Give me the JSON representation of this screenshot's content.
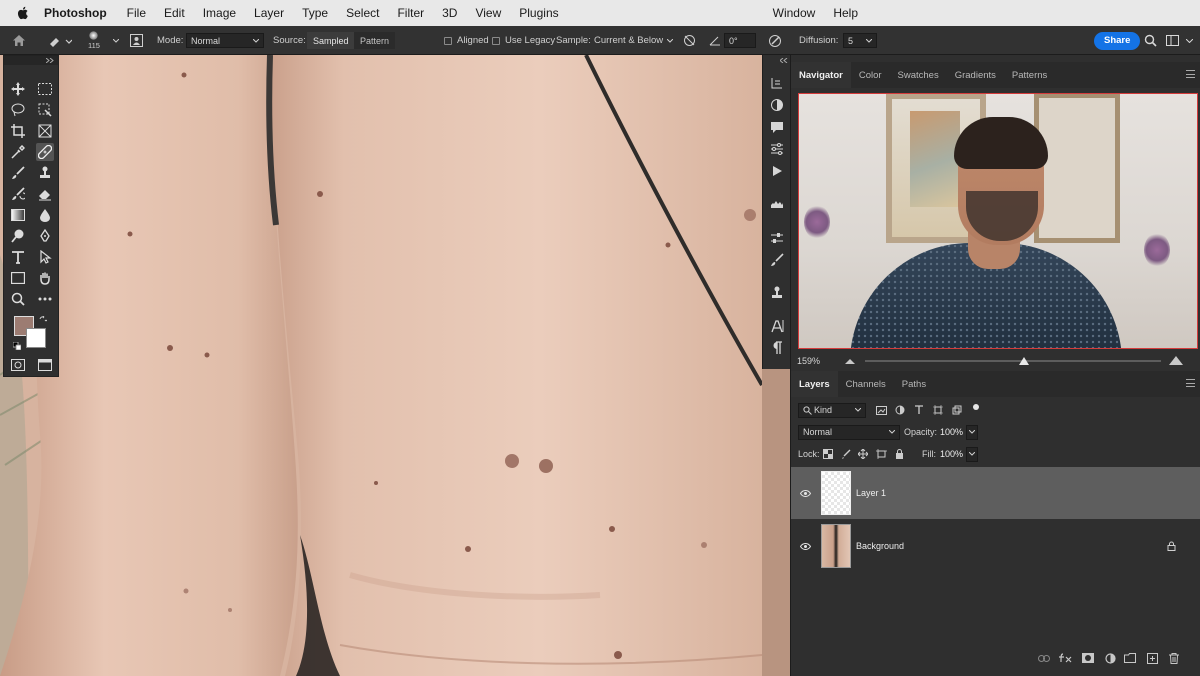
{
  "menubar": {
    "app_name": "Photoshop",
    "items": [
      "File",
      "Edit",
      "Image",
      "Layer",
      "Type",
      "Select",
      "Filter",
      "3D",
      "View",
      "Plugins"
    ],
    "right_items": [
      "Window",
      "Help"
    ]
  },
  "options_bar": {
    "brush_size": "115",
    "mode_label": "Mode:",
    "mode_value": "Normal",
    "source_label": "Source:",
    "source_sampled": "Sampled",
    "source_pattern": "Pattern",
    "aligned_label": "Aligned",
    "use_legacy_label": "Use Legacy",
    "sample_label": "Sample:",
    "sample_value": "Current & Below",
    "angle_value": "0°",
    "diffusion_label": "Diffusion:",
    "diffusion_value": "5",
    "share_label": "Share"
  },
  "navigator": {
    "tabs": [
      "Navigator",
      "Color",
      "Swatches",
      "Gradients",
      "Patterns"
    ],
    "zoom": "159%"
  },
  "layers_panel": {
    "tabs": [
      "Layers",
      "Channels",
      "Paths"
    ],
    "filter_kind": "Kind",
    "blend_mode": "Normal",
    "opacity_label": "Opacity:",
    "opacity_value": "100%",
    "lock_label": "Lock:",
    "fill_label": "Fill:",
    "fill_value": "100%",
    "layers": [
      {
        "name": "Layer 1",
        "selected": true
      },
      {
        "name": "Background",
        "selected": false,
        "locked": true
      }
    ]
  },
  "colors": {
    "foreground": "#9c7c72",
    "background": "#ffffff",
    "share_blue": "#1473e6"
  }
}
